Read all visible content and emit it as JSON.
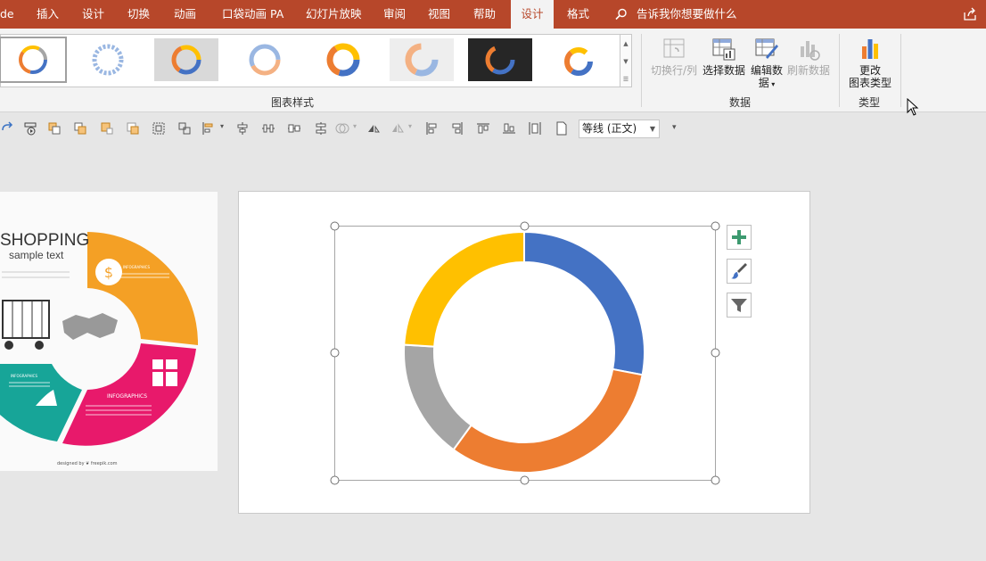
{
  "tabs": [
    {
      "label": "de"
    },
    {
      "label": "插入"
    },
    {
      "label": "设计"
    },
    {
      "label": "切换"
    },
    {
      "label": "动画"
    },
    {
      "label": "口袋动画 PA"
    },
    {
      "label": "幻灯片放映"
    },
    {
      "label": "审阅"
    },
    {
      "label": "视图"
    },
    {
      "label": "帮助"
    },
    {
      "label": "设计"
    },
    {
      "label": "格式"
    }
  ],
  "active_tab_index": 10,
  "tell_me": "告诉我你想要做什么",
  "ribbon": {
    "chart_styles_label": "图表样式",
    "data_group_label": "数据",
    "type_group_label": "类型",
    "switch_row_col": "切换行/列",
    "select_data": "选择数据",
    "edit_data_line1": "编辑数",
    "edit_data_line2": "据",
    "refresh_data": "刷新数据",
    "change_type_line1": "更改",
    "change_type_line2": "图表类型"
  },
  "font": {
    "name": "等线 (正文)"
  },
  "colors": {
    "accent": "#b7472a",
    "blue": "#4472c4",
    "orange": "#ed7d31",
    "gray": "#a5a5a5",
    "yellow": "#ffc000",
    "green_plus": "#3d9a70"
  },
  "left_thumbnail": {
    "title": "SHOPPING",
    "subtitle": "sample text",
    "label_a": "INFOGRAPHICS",
    "label_b": "INFOGRAPHICS",
    "label_c": "INFOGRAPHICS",
    "credit": "designed by ❦ freepik.com"
  },
  "side_buttons": [
    "plus-icon",
    "brush-icon",
    "filter-icon"
  ],
  "chart_data": {
    "type": "pie",
    "donut": true,
    "values": [
      28,
      32,
      16,
      24
    ],
    "colors": [
      "#4472c4",
      "#ed7d31",
      "#a5a5a5",
      "#ffc000"
    ],
    "title": "",
    "legend": "none"
  }
}
